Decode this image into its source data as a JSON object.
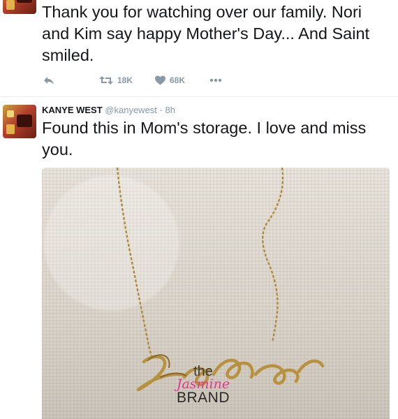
{
  "tweet1": {
    "text": "Thank you for watching over our family. Nori and Kim say happy Mother's Day... And Saint smiled.",
    "actions": {
      "retweets": "18K",
      "likes": "68K"
    }
  },
  "tweet2": {
    "author_name": "KANYE WEST",
    "handle": "@kanyewest",
    "separator": "·",
    "time": "8h",
    "text": "Found this in Mom's storage.  I love and miss you."
  },
  "watermark": {
    "the": "the",
    "jasmine": "Jasmine",
    "brand": "BRAND"
  },
  "icons": {
    "reply": "reply-icon",
    "retweet": "retweet-icon",
    "like": "heart-icon",
    "more": "more-icon"
  },
  "colors": {
    "text": "#14171a",
    "muted": "#8899a6",
    "watermark_pink": "#e0388a"
  }
}
